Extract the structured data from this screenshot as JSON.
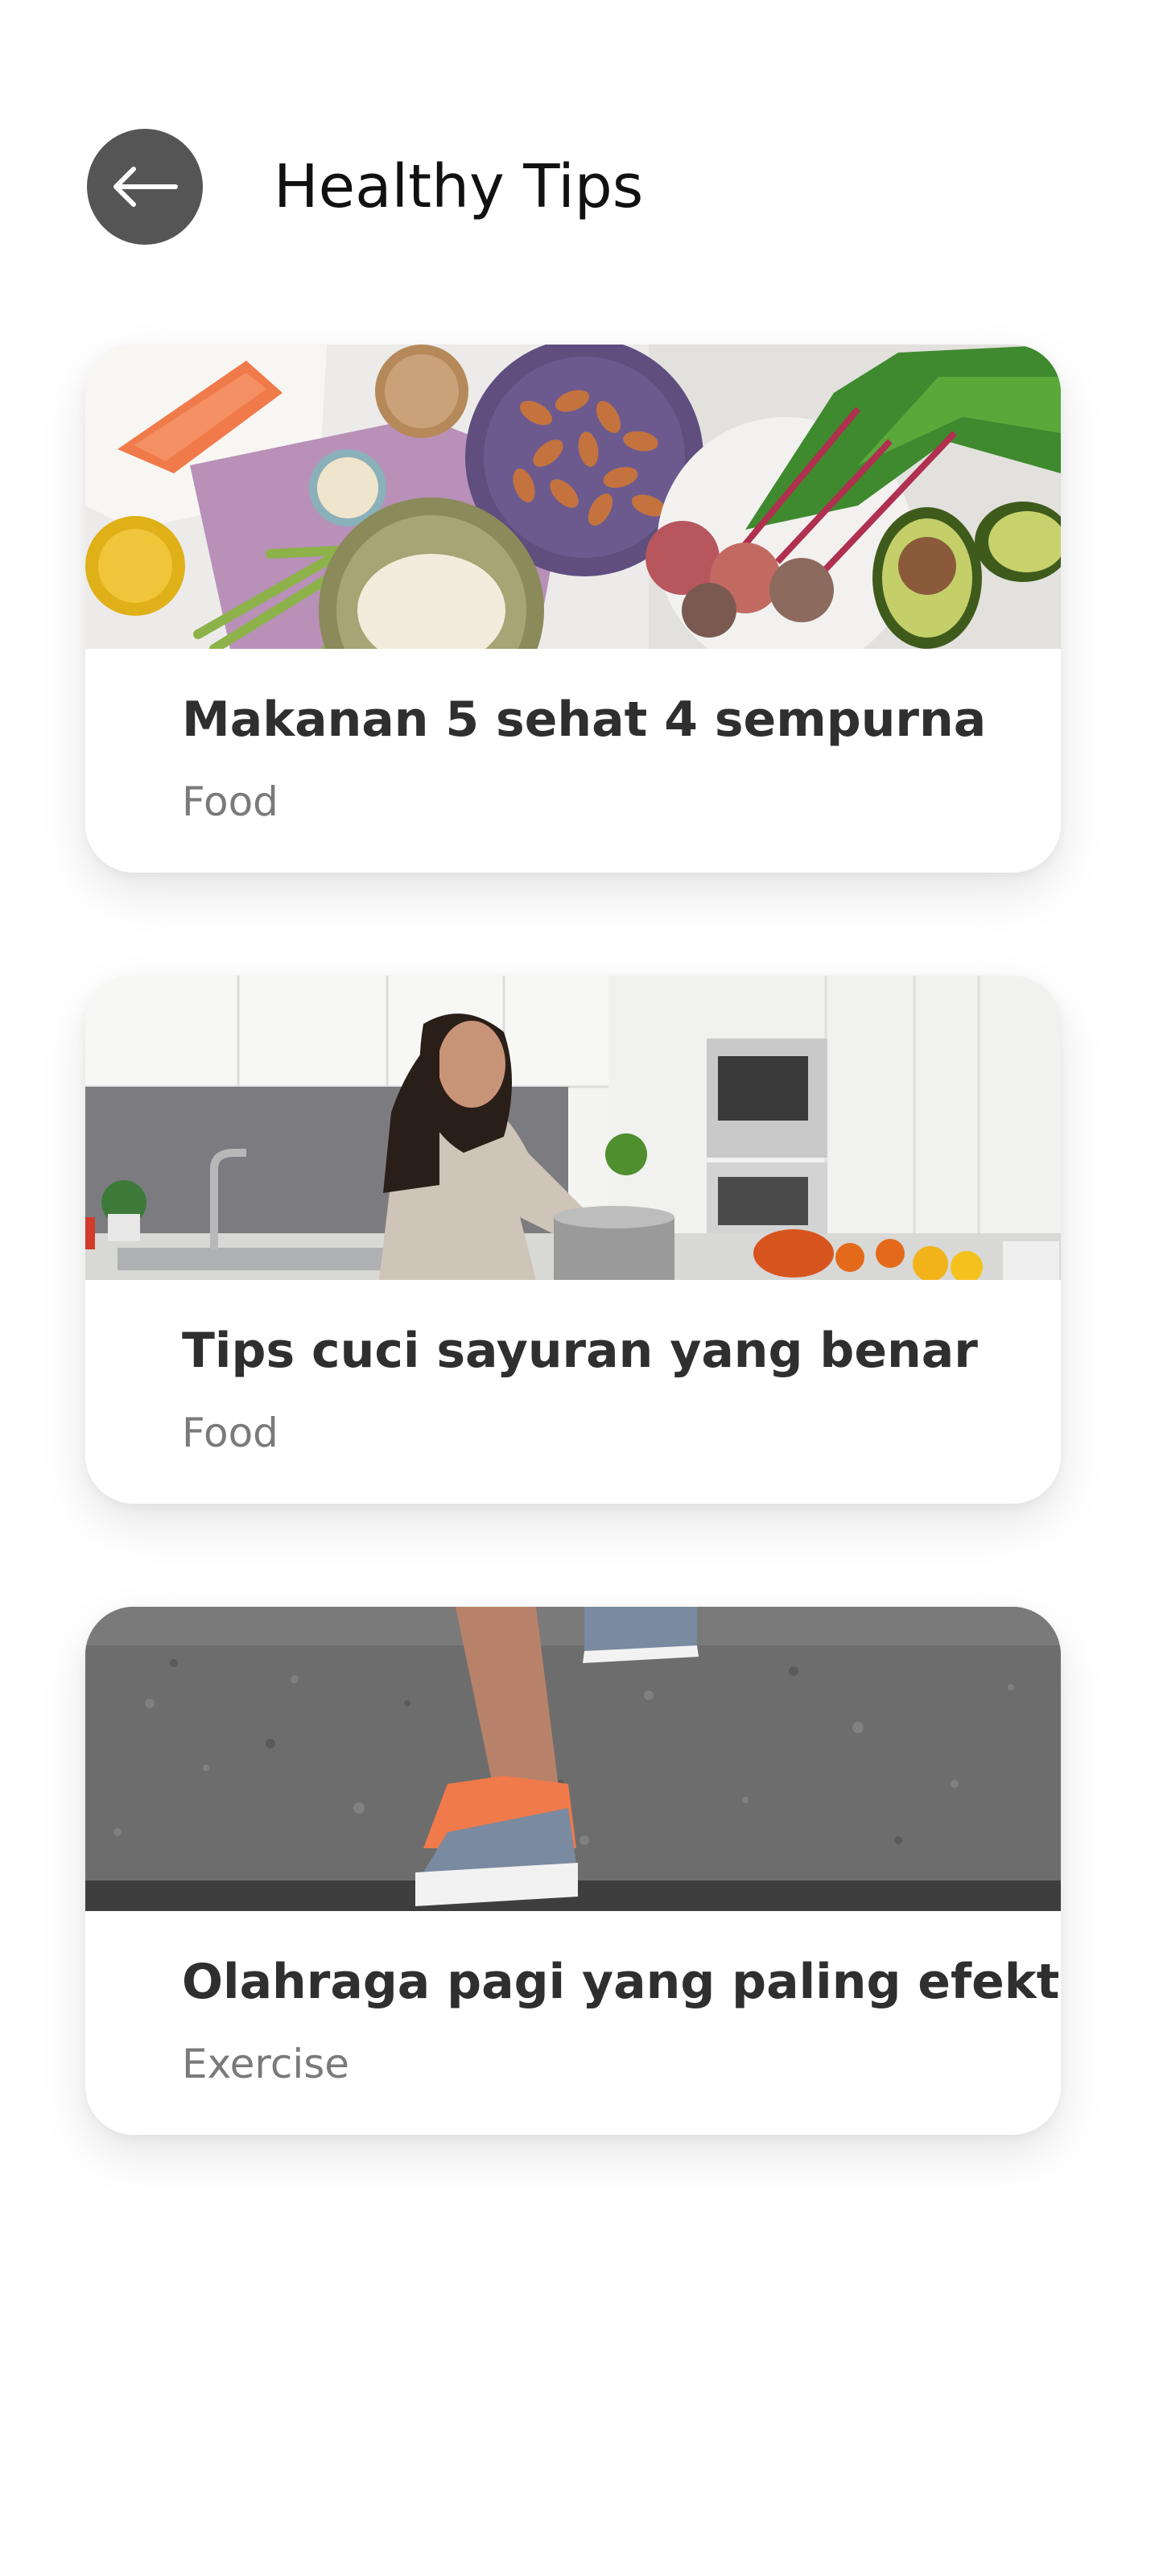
{
  "header": {
    "title": "Healthy Tips",
    "back_icon": "arrow-left-icon"
  },
  "tips": [
    {
      "title": "Makanan 5 sehat 4 sempurna",
      "category": "Food",
      "image": "healthy-food-flatlay-image"
    },
    {
      "title": "Tips cuci sayuran yang benar",
      "category": "Food",
      "image": "woman-washing-vegetables-kitchen-image"
    },
    {
      "title": "Olahraga pagi yang paling efektif",
      "category": "Exercise",
      "image": "running-shoes-on-stairs-image"
    }
  ],
  "colors": {
    "back_button": "#555555",
    "title_text": "#111111",
    "card_title": "#2f2f2f",
    "category_text": "#7a7a7a",
    "background": "#ffffff"
  }
}
